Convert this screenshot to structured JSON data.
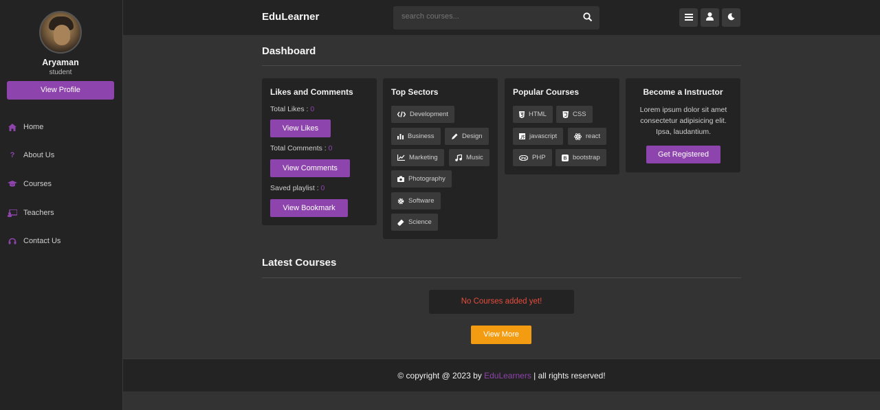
{
  "sidebar": {
    "user_name": "Aryaman",
    "user_role": "student",
    "view_profile_label": "View Profile",
    "nav": [
      {
        "label": "Home",
        "icon": "home-icon"
      },
      {
        "label": "About Us",
        "icon": "question-icon"
      },
      {
        "label": "Courses",
        "icon": "graduation-cap-icon"
      },
      {
        "label": "Teachers",
        "icon": "chalkboard-teacher-icon"
      },
      {
        "label": "Contact Us",
        "icon": "headset-icon"
      }
    ]
  },
  "header": {
    "brand": "EduLearner",
    "search_placeholder": "search courses..."
  },
  "dashboard": {
    "title": "Dashboard",
    "likes_card": {
      "title": "Likes and Comments",
      "total_likes_label": "Total Likes : ",
      "total_likes": "0",
      "view_likes_label": "View Likes",
      "total_comments_label": "Total Comments : ",
      "total_comments": "0",
      "view_comments_label": "View Comments",
      "saved_playlist_label": "Saved playlist : ",
      "saved_playlist": "0",
      "view_bookmark_label": "View Bookmark"
    },
    "sectors_card": {
      "title": "Top Sectors",
      "items": [
        {
          "label": "Development",
          "icon": "code-icon"
        },
        {
          "label": "Business",
          "icon": "bar-chart-icon"
        },
        {
          "label": "Design",
          "icon": "pen-icon"
        },
        {
          "label": "Marketing",
          "icon": "line-chart-icon"
        },
        {
          "label": "Music",
          "icon": "music-icon"
        },
        {
          "label": "Photography",
          "icon": "camera-icon"
        },
        {
          "label": "Software",
          "icon": "cog-icon"
        },
        {
          "label": "Science",
          "icon": "vial-icon"
        }
      ]
    },
    "popular_card": {
      "title": "Popular Courses",
      "items": [
        {
          "label": "HTML",
          "icon": "html5-icon"
        },
        {
          "label": "CSS",
          "icon": "css3-icon"
        },
        {
          "label": "javascript",
          "icon": "js-icon"
        },
        {
          "label": "react",
          "icon": "react-icon"
        },
        {
          "label": "PHP",
          "icon": "php-icon"
        },
        {
          "label": "bootstrap",
          "icon": "bootstrap-icon"
        }
      ]
    },
    "instructor_card": {
      "title": "Become a Instructor",
      "text": "Lorem ipsum dolor sit amet consectetur adipisicing elit. Ipsa, laudantium.",
      "button_label": "Get Registered"
    }
  },
  "latest": {
    "title": "Latest Courses",
    "empty_message": "No Courses added yet!",
    "view_more_label": "View More"
  },
  "footer": {
    "prefix": "© copyright @ 2023 by ",
    "brand": "EduLearners",
    "suffix": " | all rights reserved!"
  },
  "colors": {
    "accent": "#8e44ad",
    "warning": "#f39c12",
    "error": "#e74c3c",
    "panel": "#232323",
    "background": "#333333"
  }
}
